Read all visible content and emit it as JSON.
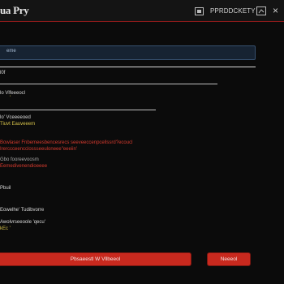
{
  "header": {
    "title": "ua Pry",
    "link_label": "PPRDDCKETY"
  },
  "form": {
    "field_label": "eme",
    "label_a": "l0f",
    "label_b": "lo Vlfeeeocl",
    "label_b_mark": "'",
    "label_c": "lo' Vceeeeoed",
    "label_d": "Tiuvt Eauveeem",
    "label_e": "Bowlaser Fnbemeesbencesrecs seeveeccenpcellssrd?ecoucl",
    "label_f": "Irerccceencclossseeuloneee\"eeeiin'",
    "label_g": "Gbo fooreevoosm",
    "label_h": "Eemedivenendioeeee",
    "label_i": "Pbuil",
    "label_j": "Eowelhe' Tudibvorre",
    "label_k": "Awolvrseeoole 'qecu'",
    "label_k_mark": "'",
    "label_l": "kEc '"
  },
  "actions": {
    "primary_label": "Pbsaeestl W Vllbeeol",
    "secondary_label": "Neeeol"
  }
}
